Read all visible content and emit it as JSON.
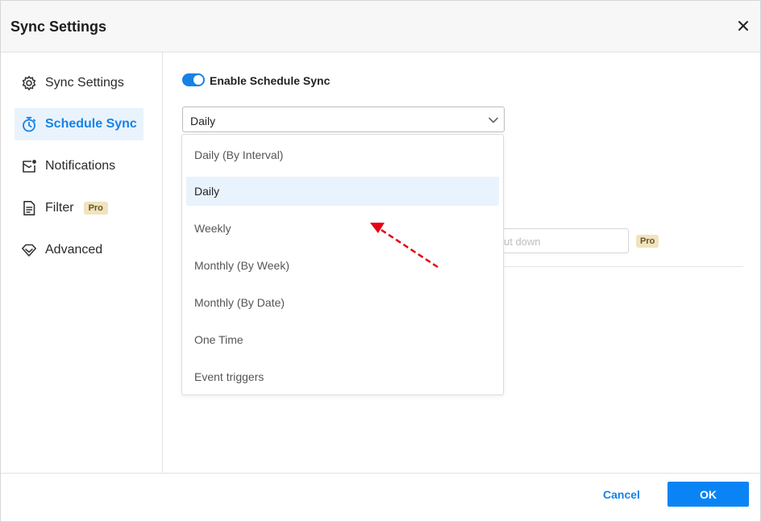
{
  "dialog": {
    "title": "Sync Settings",
    "close_icon": "close-icon"
  },
  "sidebar": {
    "items": [
      {
        "label": "Sync Settings",
        "icon": "gear-icon",
        "active": false
      },
      {
        "label": "Schedule Sync",
        "icon": "stopwatch-icon",
        "active": true
      },
      {
        "label": "Notifications",
        "icon": "mail-notification-icon",
        "active": false
      },
      {
        "label": "Filter",
        "icon": "document-filter-icon",
        "active": false,
        "badge": "Pro"
      },
      {
        "label": "Advanced",
        "icon": "diamond-icon",
        "active": false
      }
    ]
  },
  "schedule": {
    "enable_label": "Enable Schedule Sync",
    "enabled": true,
    "frequency_value": "Daily",
    "options": [
      "Daily (By Interval)",
      "Daily",
      "Weekly",
      "Monthly (By Week)",
      "Monthly (By Date)",
      "One Time",
      "Event triggers"
    ],
    "selected_option": "Daily",
    "background_placeholder": "ut down",
    "background_badge": "Pro"
  },
  "footer": {
    "cancel_label": "Cancel",
    "ok_label": "OK"
  },
  "colors": {
    "accent": "#1682e6",
    "ok_button": "#0a84f4",
    "annotation_arrow": "#e60012"
  }
}
